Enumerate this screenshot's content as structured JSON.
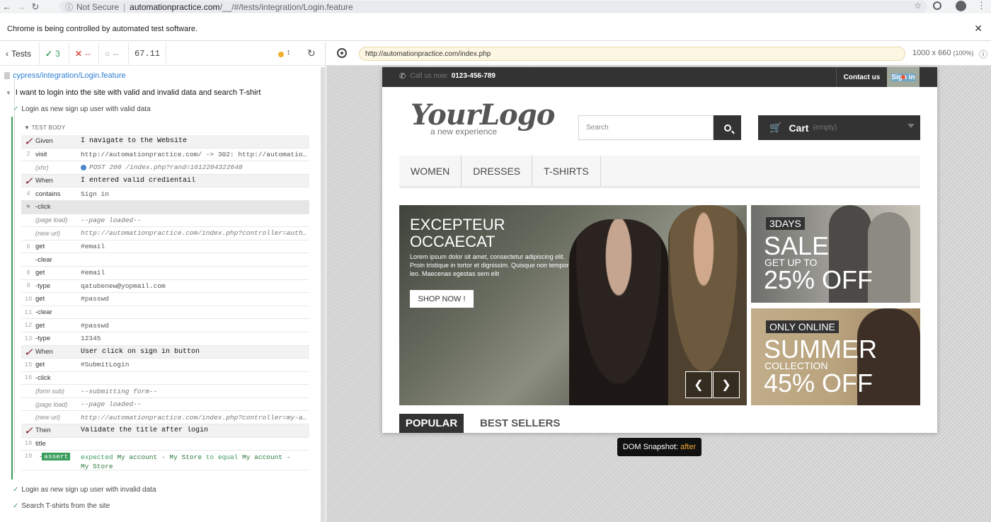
{
  "browser": {
    "security_label": "Not Secure",
    "url_host": "automationpractice.com",
    "url_path": "/__/#/tests/integration/Login.feature",
    "infobar_text": "Chrome is being controlled by automated test software."
  },
  "reporter": {
    "tests_label": "Tests",
    "passed": "3",
    "failed": "--",
    "pending": "--",
    "duration": "67.11",
    "spec_file": "cypress/integration/Login.feature",
    "suite_title": "I want to login into the site with valid and invalid data and search T-shirt",
    "test_title": "Login as new sign up user with valid data",
    "test_body_label": "TEST BODY",
    "commands": [
      {
        "num": "",
        "name": "Given",
        "msg": "I navigate to the Website",
        "kind": "step"
      },
      {
        "num": "2",
        "name": "visit",
        "msg": "http://automationpractice.com/ -> 302: http://automatio…",
        "kind": "cmd"
      },
      {
        "num": "",
        "name": "(xhr)",
        "msg": "POST 200 /index.php?rand=1612204322648",
        "kind": "xhr"
      },
      {
        "num": "",
        "name": "When",
        "msg": "I entered valid credientail",
        "kind": "step"
      },
      {
        "num": "4",
        "name": "contains",
        "msg": "Sign in",
        "kind": "cmd"
      },
      {
        "num": "",
        "name": "-click",
        "msg": "",
        "kind": "pinned"
      },
      {
        "num": "",
        "name": "(page load)",
        "msg": "--page loaded--",
        "kind": "event"
      },
      {
        "num": "",
        "name": "(new url)",
        "msg": "http://automationpractice.com/index.php?controller=auth…",
        "kind": "event"
      },
      {
        "num": "6",
        "name": "get",
        "msg": "#email",
        "kind": "cmd"
      },
      {
        "num": "",
        "name": "-clear",
        "msg": "",
        "kind": "child"
      },
      {
        "num": "8",
        "name": "get",
        "msg": "#email",
        "kind": "cmd"
      },
      {
        "num": "9",
        "name": "-type",
        "msg": "qatubenew@yopmail.com",
        "kind": "child"
      },
      {
        "num": "10",
        "name": "get",
        "msg": "#passwd",
        "kind": "cmd"
      },
      {
        "num": "11",
        "name": "-clear",
        "msg": "",
        "kind": "child"
      },
      {
        "num": "12",
        "name": "get",
        "msg": "#passwd",
        "kind": "cmd"
      },
      {
        "num": "13",
        "name": "-type",
        "msg": "12345",
        "kind": "child"
      },
      {
        "num": "",
        "name": "When",
        "msg": "User click on sign in button",
        "kind": "step"
      },
      {
        "num": "15",
        "name": "get",
        "msg": "#SubmitLogin",
        "kind": "cmd"
      },
      {
        "num": "16",
        "name": "-click",
        "msg": "",
        "kind": "child"
      },
      {
        "num": "",
        "name": "(form sub)",
        "msg": "--submitting form--",
        "kind": "event"
      },
      {
        "num": "",
        "name": "(page load)",
        "msg": "--page loaded--",
        "kind": "event"
      },
      {
        "num": "",
        "name": "(new url)",
        "msg": "http://automationpractice.com/index.php?controller=my-a…",
        "kind": "event"
      },
      {
        "num": "",
        "name": "Then",
        "msg": "Validate the title after login",
        "kind": "step"
      },
      {
        "num": "18",
        "name": "title",
        "msg": "",
        "kind": "cmd"
      }
    ],
    "assert": {
      "num": "19",
      "badge": "assert",
      "w1": "expected",
      "v1": "My account - My Store",
      "w2": "to equal",
      "v2": "My account -",
      "v3": "My Store"
    },
    "other_tests": [
      "Login as new sign up user with invalid data",
      "Search T-shirts from the site"
    ]
  },
  "aut": {
    "url": "http://automationpractice.com/index.php",
    "viewport": "1000 x 660",
    "viewport_pct": "(100%)",
    "snapshot_label": "DOM Snapshot:",
    "snapshot_state": "after"
  },
  "store": {
    "call_label": "Call us now:",
    "phone": "0123-456-789",
    "contact": "Contact us",
    "signin": "Sign in",
    "logo_main": "YourLogo",
    "logo_tag": "a new experience",
    "search_placeholder": "Search",
    "cart_label": "Cart",
    "cart_state": "(empty)",
    "menu": [
      "WOMEN",
      "DRESSES",
      "T-SHIRTS"
    ],
    "slide_title_1": "EXCEPTEUR",
    "slide_title_2": "OCCAECAT",
    "slide_text": "Lorem ipsum dolor sit amet, consectetur adipiscing elit. Proin tristique in tortor et dignissim. Quisque non tempor leo. Maecenas egestas sem elit",
    "shop_now": "SHOP NOW !",
    "promo1_tag": "3DAYS",
    "promo1_big": "SALE",
    "promo1_mid": "GET UP TO",
    "promo1_off": "25% OFF",
    "promo2_tag": "ONLY ONLINE",
    "promo2_big": "SUMMER",
    "promo2_mid": "COLLECTION",
    "promo2_off": "45% OFF",
    "tab_popular": "POPULAR",
    "tab_best": "BEST SELLERS"
  }
}
